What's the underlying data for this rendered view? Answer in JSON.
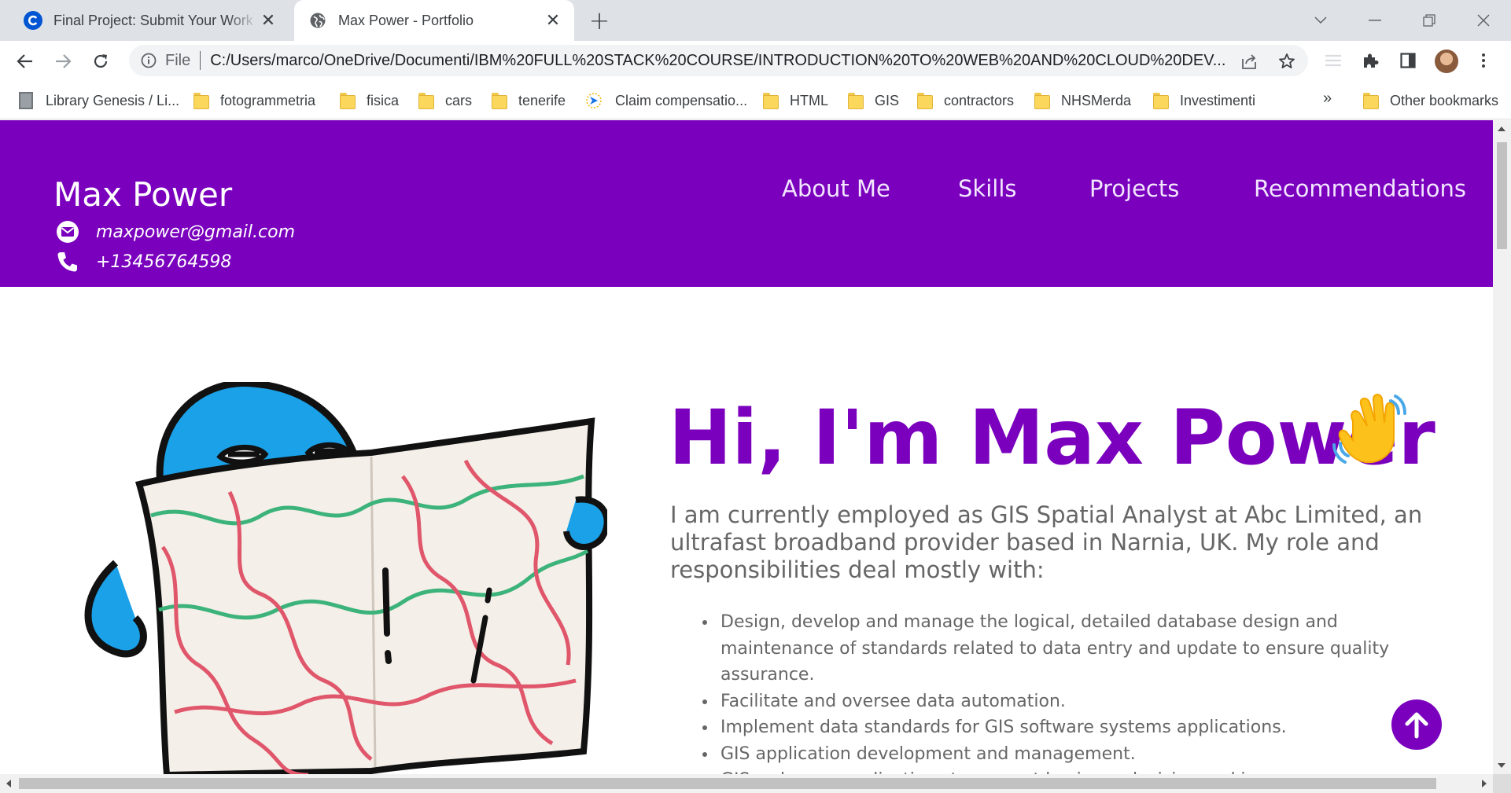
{
  "browser": {
    "tabs": [
      {
        "title": "Final Project: Submit Your Work and Get Graded",
        "favicon": "coursera-icon",
        "active": false
      },
      {
        "title": "Max Power - Portfolio",
        "favicon": "globe-icon",
        "active": true
      }
    ],
    "address": {
      "scheme_label": "File",
      "url": "C:/Users/marco/OneDrive/Documenti/IBM%20FULL%20STACK%20COURSE/INTRODUCTION%20TO%20WEB%20AND%20CLOUD%20DEV..."
    },
    "bookmarks": [
      {
        "label": "Library Genesis / Li...",
        "icon": "book-icon"
      },
      {
        "label": "fotogrammetria",
        "icon": "folder-icon"
      },
      {
        "label": "fisica",
        "icon": "folder-icon"
      },
      {
        "label": "cars",
        "icon": "folder-icon"
      },
      {
        "label": "tenerife",
        "icon": "folder-icon"
      },
      {
        "label": "Claim compensatio...",
        "icon": "plane-icon"
      },
      {
        "label": "HTML",
        "icon": "folder-icon"
      },
      {
        "label": "GIS",
        "icon": "folder-icon"
      },
      {
        "label": "contractors",
        "icon": "folder-icon"
      },
      {
        "label": "NHSMerda",
        "icon": "folder-icon"
      },
      {
        "label": "Investimenti",
        "icon": "folder-icon"
      }
    ],
    "bookmarks_overflow": "»",
    "other_bookmarks": "Other bookmarks"
  },
  "site": {
    "brand": "Max Power",
    "email": "maxpower@gmail.com",
    "phone": "+13456764598",
    "nav": [
      "About Me",
      "Skills",
      "Projects",
      "Recommendations"
    ],
    "accent_color": "#7a00be"
  },
  "hero": {
    "title": "Hi, I'm Max Power",
    "intro": "I am currently employed as GIS Spatial Analyst at Abc Limited, an ultrafast broadband provider based in Narnia, UK. My role and responsibilities deal mostly with:",
    "duties": [
      "Design, develop and manage the logical, detailed database design and maintenance of standards related to data entry and update to ensure quality assurance.",
      "Facilitate and oversee data automation.",
      "Implement data standards for GIS software systems applications.",
      "GIS application development and management.",
      "GIS web map applications to support business decision making."
    ]
  }
}
